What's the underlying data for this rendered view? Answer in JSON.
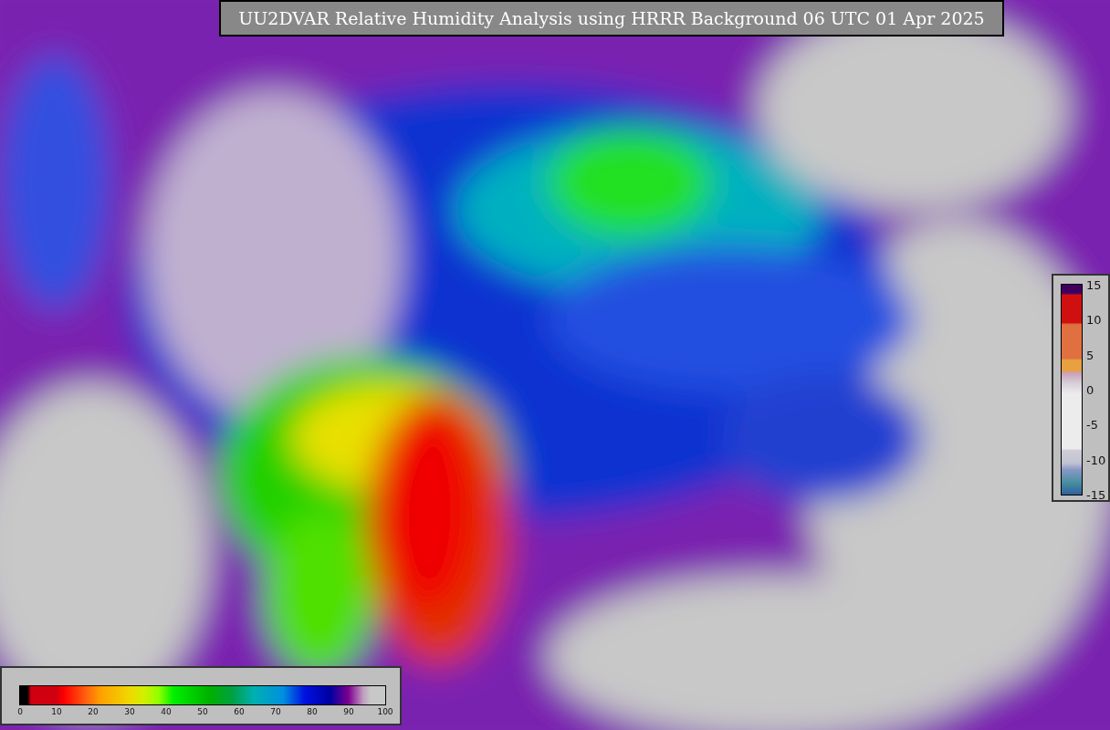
{
  "title": "UU2DVAR Relative Humidity Analysis using HRRR Background 06 UTC 01 Apr 2025",
  "humidity_colorbar": {
    "ticks": [
      "0",
      "10",
      "20",
      "30",
      "40",
      "50",
      "60",
      "70",
      "80",
      "90",
      "100"
    ]
  },
  "difference_colorbar": {
    "ticks": [
      "15",
      "10",
      "5",
      "0",
      "-5",
      "-10",
      "-15"
    ]
  }
}
